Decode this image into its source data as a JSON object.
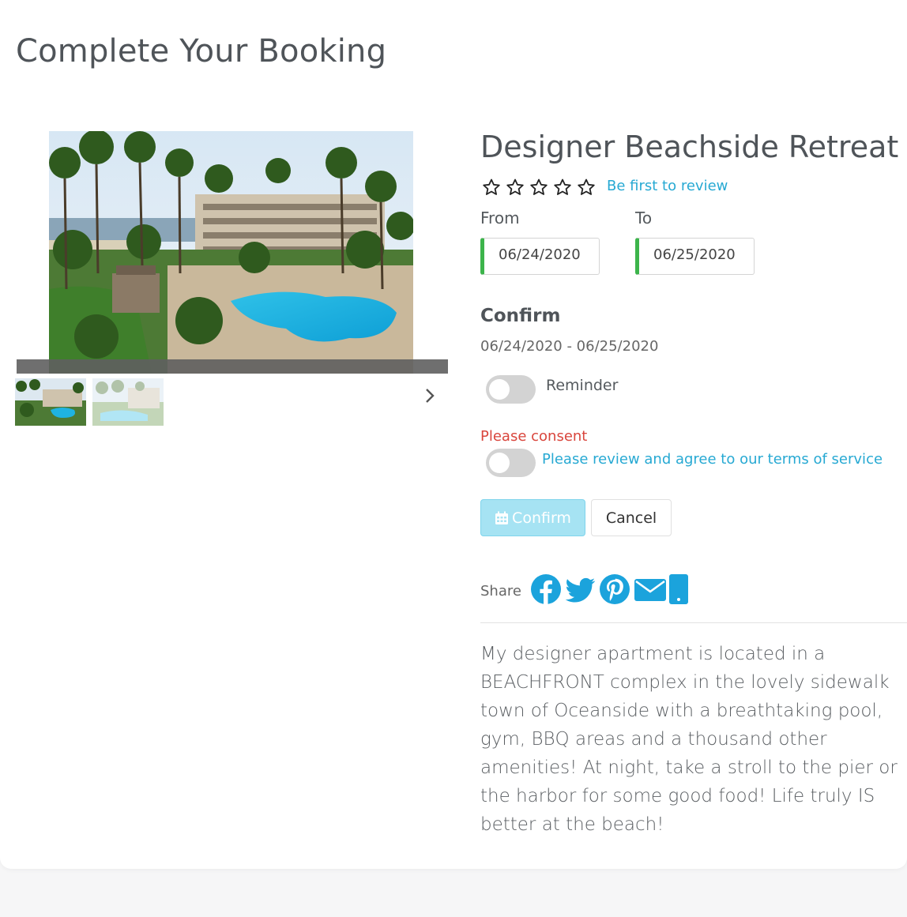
{
  "page": {
    "title": "Complete Your Booking"
  },
  "property": {
    "name": "Designer Beachside Retreat",
    "rating_stars": 0,
    "rating_max": 5,
    "review_link": "Be first to review",
    "description": "My designer apartment is located in a BEACHFRONT complex in the lovely sidewalk town of Oceanside with a breathtaking pool, gym, BBQ areas and a thousand other amenities! At night, take a stroll to the pier or the harbor for some good food! Life truly IS better at the beach!"
  },
  "gallery": {
    "thumbnail_count": 2,
    "next_icon": "chevron-right-icon"
  },
  "booking": {
    "from_label": "From",
    "from_value": "06/24/2020",
    "to_label": "To",
    "to_value": "06/25/2020",
    "confirm_heading": "Confirm",
    "date_range": "06/24/2020 - 06/25/2020",
    "reminder_label": "Reminder",
    "reminder_on": false,
    "consent_error": "Please consent",
    "terms_label": "Please review and agree to our terms of service",
    "terms_on": false,
    "confirm_button": "Confirm",
    "confirm_icon": "calendar-icon",
    "cancel_button": "Cancel"
  },
  "share": {
    "label": "Share",
    "icons": [
      "facebook-icon",
      "twitter-icon",
      "pinterest-icon",
      "email-icon",
      "mobile-icon"
    ]
  },
  "colors": {
    "accent": "#27a9d3",
    "icon_blue": "#1ba3dc",
    "error": "#d9453c",
    "valid_border": "#3cb44b",
    "confirm_bg": "#a6e3f3"
  }
}
